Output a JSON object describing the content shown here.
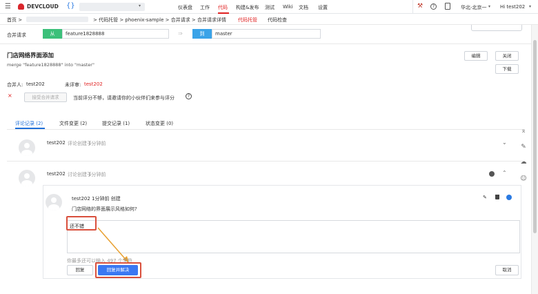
{
  "topbar": {
    "brand": "DEVCLOUD",
    "nav": [
      "仪表盘",
      "工作",
      "代码",
      "构建&发布",
      "测试",
      "Wiki",
      "文档",
      "设置"
    ],
    "region": "华北-北京一",
    "user": "Hi test202"
  },
  "breadcrumb": {
    "home": "首页 >",
    "path": "> 代码托管 > phoenix-sample > 合并请求 > 合并请求详情",
    "tab_hosting": "代码托管",
    "tab_check": "代码检查"
  },
  "merge_bar": {
    "label": "合并请求",
    "from_badge": "从",
    "from_branch": "feature1828888",
    "arrow": "⇒",
    "to_badge": "到",
    "to_branch": "master"
  },
  "request": {
    "title": "门店网络界面添加",
    "subtitle": "merge \"feature1828888\" into \"master\"",
    "edit": "编辑",
    "close": "关闭",
    "download": "下载",
    "merger_label": "合并人:",
    "merger": "test202",
    "reviewer_label": "未评审:",
    "reviewer": "test202",
    "x_mark": "×",
    "accept_btn": "接受合并请求",
    "score_notice": "当前评分不够，请邀请你的小伙伴们来参与评分",
    "help": "?"
  },
  "tabs": [
    "评论记录 (2)",
    "文件变更 (2)",
    "提交记录 (1)",
    "状态变更 (0)"
  ],
  "comments": [
    {
      "author": "test202",
      "action": "评论创建于",
      "time": "1分钟前"
    },
    {
      "author": "test202",
      "action": "讨论创建于",
      "time": "1分钟前"
    }
  ],
  "reply": {
    "header": "test202  1分钟前 创建",
    "question": "门店网络的界面展示风格如何?",
    "draft_text": "还不错",
    "char_hint": "你最多还可以输入 497 个字符",
    "reply_btn": "回复",
    "resolve_btn": "回复并解决",
    "cancel_btn": "取消"
  },
  "colors": {
    "accent": "#3a78f2",
    "from_badge": "#3cc07a",
    "to_badge": "#3aa3e8",
    "highlight": "#d94f3c",
    "arrow": "#e8a030",
    "brand_red": "#d9262c"
  }
}
